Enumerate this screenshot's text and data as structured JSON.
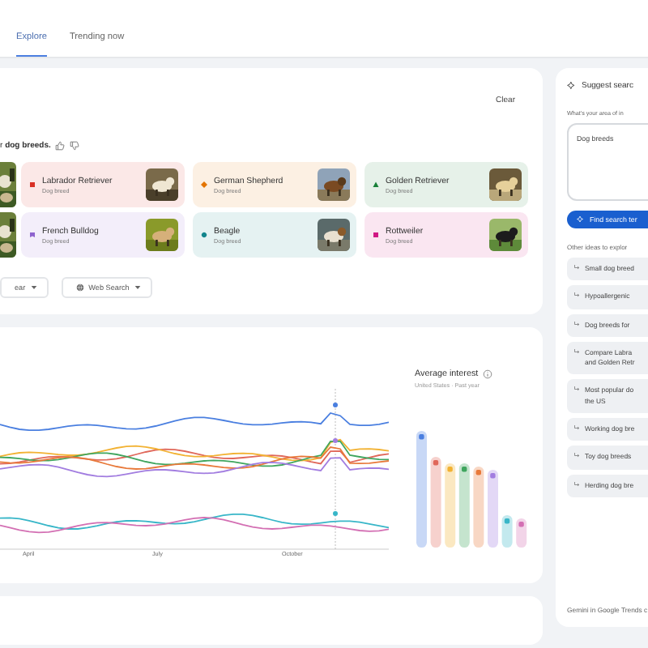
{
  "tabs": [
    {
      "label": "Explore",
      "selected": true
    },
    {
      "label": "Trending now",
      "selected": false
    }
  ],
  "clear_button": "Clear",
  "prompt_text": "r **dog breeds.**",
  "topic_cards": [
    {
      "name": "Labrador Retriever",
      "subtitle": "Dog breed",
      "color": "#d93025"
    },
    {
      "name": "German Shepherd",
      "subtitle": "Dog breed",
      "color": "#e37400"
    },
    {
      "name": "Golden Retriever",
      "subtitle": "Dog breed",
      "color": "#188038"
    },
    {
      "name": "French Bulldog",
      "subtitle": "Dog breed",
      "color": "#8e63ce"
    },
    {
      "name": "Beagle",
      "subtitle": "Dog breed",
      "color": "#12858c"
    },
    {
      "name": "Rottweiler",
      "subtitle": "Dog breed",
      "color": "#d01884"
    }
  ],
  "filters": [
    {
      "label": "ear"
    },
    {
      "label": "Web Search"
    }
  ],
  "chart_panel": {
    "month_labels": [
      "April",
      "July",
      "October"
    ],
    "average_interest_title": "Average interest",
    "average_interest_subtitle": "United States · Past year"
  },
  "suggest_panel": {
    "title": "Suggest searc",
    "question": "What's your area of in",
    "input_value": "Dog breeds",
    "find_button": "Find search ter",
    "ideas_heading": "Other ideas to explor",
    "ideas": [
      "Small dog breed",
      "Hypoallergenic",
      "Dog breeds for",
      "Compare Labra\nand Golden Retr",
      "Most popular do\nthe US",
      "Working dog bre",
      "Toy dog breeds",
      "Herding dog bre"
    ],
    "footer": "Gemini in Google Trends c"
  }
}
